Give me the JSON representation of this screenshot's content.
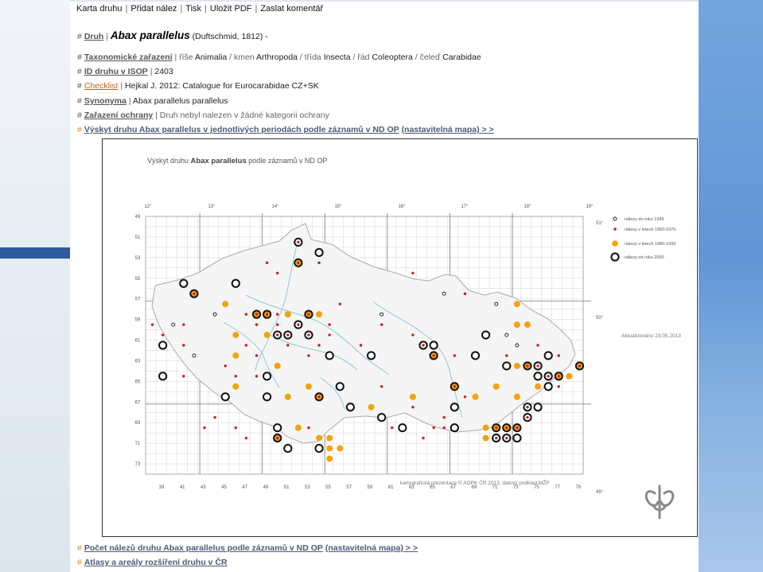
{
  "toolbar": {
    "items": [
      "Karta druhu",
      "Přidat nález",
      "Tisk",
      "Uložit PDF",
      "Zaslat komentář"
    ]
  },
  "rows": {
    "druh": {
      "label": "Druh",
      "name": "Abax parallelus",
      "author": "(Duftschmid, 1812)",
      "dash": "-"
    },
    "taxonomy": {
      "label": "Taxonomické zařazení",
      "text1": "říše",
      "v1": "Animalia",
      "text2": "kmen",
      "v2": "Arthropoda",
      "text3": "třída",
      "v3": "Insecta",
      "text4": "řád",
      "v4": "Coleoptera",
      "text5": "čeleď",
      "v5": "Carabidae"
    },
    "isop": {
      "label": "ID druhu v ISOP",
      "value": "2403"
    },
    "checklist": {
      "label": "Checklist",
      "value": "Hejkal J. 2012: Catalogue for Eurocarabidae CZ+SK"
    },
    "synonyma": {
      "label": "Synonyma",
      "value": "Abax parallelus parallelus"
    },
    "protection": {
      "label": "Zařazení ochrany",
      "value": "Druh nebyl nalezen v žádné kategorii ochrany"
    },
    "occurrence": {
      "label": "Výskyt druhu Abax parallelus v jednotlivých periodách podle záznamů v ND OP",
      "link": "(nastavitelná mapa) > >"
    },
    "count": {
      "label": "Počet nálezů druhu Abax parallelus podle záznamů v ND OP",
      "link": "(nastavitelná mapa) > >"
    },
    "atlas": {
      "label": "Atlasy a areály rozšíření druhu v ČR"
    }
  },
  "map": {
    "title_prefix": "Výskyt druhu",
    "title_species": "Abax parallelus",
    "title_suffix": "podle záznamů v ND OP",
    "top_lon_labels": [
      "12°",
      "13°",
      "14°",
      "15°",
      "16°",
      "17°",
      "18°",
      "19°"
    ],
    "lat_labels": [
      "51°",
      "50°",
      "49°"
    ],
    "left_row_labels": [
      "49",
      "51",
      "53",
      "55",
      "57",
      "59",
      "61",
      "63",
      "65",
      "67",
      "69",
      "71",
      "73"
    ],
    "bottom_col_labels": [
      "39",
      "41",
      "43",
      "45",
      "47",
      "49",
      "51",
      "53",
      "55",
      "57",
      "59",
      "61",
      "63",
      "65",
      "67",
      "69",
      "71",
      "73",
      "75",
      "77",
      "79"
    ],
    "legend": [
      {
        "label": "nálezy do roku 1949",
        "kind": "small-open"
      },
      {
        "label": "nálezy v letech 1950-1979",
        "kind": "red-dot"
      },
      {
        "label": "nálezy v letech 1980-1999",
        "kind": "orange-dot"
      },
      {
        "label": "nálezy od roku 2000",
        "kind": "big-open"
      }
    ],
    "updated": "Aktualizováno 23.05.2013",
    "credit": "kartografická prezentace © AOPK ČR 2013, datový podklad MŽP",
    "colors": {
      "red": "#cc1b1b",
      "orange": "#f4a20e",
      "ring": "#111111",
      "river": "#8cc8d8",
      "grid": "#c8c8c8"
    }
  }
}
